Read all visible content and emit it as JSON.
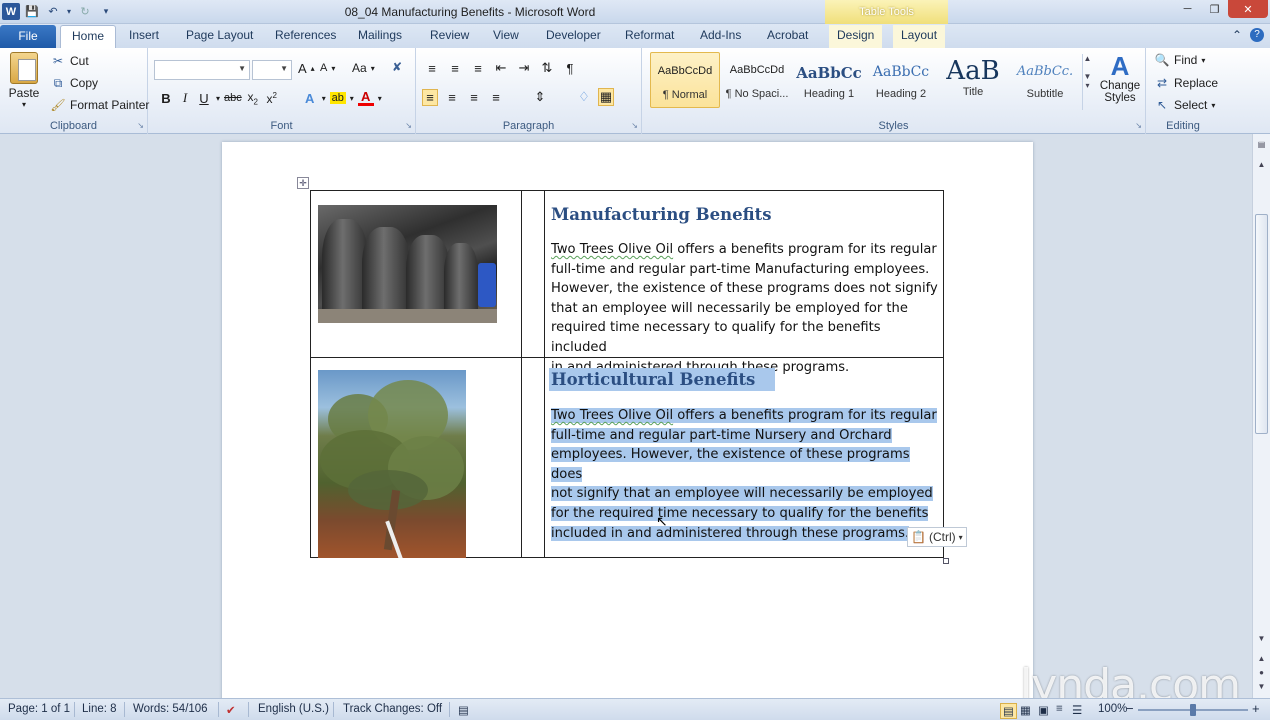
{
  "app": {
    "window_title": "08_04 Manufacturing Benefits - Microsoft Word",
    "contextual_group": "Table Tools"
  },
  "tabs": {
    "file": "File",
    "items": [
      "Home",
      "Insert",
      "Page Layout",
      "References",
      "Mailings",
      "Review",
      "View",
      "Developer",
      "Reformat",
      "Add-Ins",
      "Acrobat",
      "Design",
      "Layout"
    ],
    "active": "Home"
  },
  "ribbon": {
    "clipboard": {
      "label": "Clipboard",
      "paste": "Paste",
      "cut": "Cut",
      "copy": "Copy",
      "format_painter": "Format Painter"
    },
    "font": {
      "label": "Font",
      "font_name": "",
      "font_size": ""
    },
    "paragraph": {
      "label": "Paragraph"
    },
    "styles": {
      "label": "Styles",
      "items": [
        {
          "sample": "AaBbCcDd",
          "name": "¶ Normal"
        },
        {
          "sample": "AaBbCcDd",
          "name": "¶ No Spaci..."
        },
        {
          "sample": "AaBbCc",
          "name": "Heading 1"
        },
        {
          "sample": "AaBbCc",
          "name": "Heading 2"
        },
        {
          "sample": "AaB",
          "name": "Title"
        },
        {
          "sample": "AaBbCc.",
          "name": "Subtitle"
        }
      ],
      "change_styles": "Change Styles"
    },
    "editing": {
      "label": "Editing",
      "find": "Find",
      "replace": "Replace",
      "select": "Select"
    }
  },
  "document": {
    "section1": {
      "heading": "Manufacturing Benefits",
      "company": "Two Trees Olive Oil",
      "lines": [
        " offers a benefits program for its regular",
        "full-time and regular part-time Manufacturing employees.",
        "However, the existence of these programs does not signify",
        "that an employee will necessarily be employed for the",
        "required time necessary to qualify for the benefits included",
        "in and administered through these programs."
      ]
    },
    "section2": {
      "heading": "Horticultural Benefits",
      "company": "Two Trees Olive Oil",
      "lines": [
        " offers a benefits program for its regular",
        "full-time and regular part-time Nursery and Orchard",
        "employees. However, the existence of these programs does",
        "not signify that an employee will necessarily be employed",
        "for the required time necessary to qualify for the benefits",
        "included in and administered through these programs."
      ]
    },
    "paste_options": "(Ctrl)"
  },
  "status": {
    "page": "Page: 1 of 1",
    "line": "Line: 8",
    "words": "Words: 54/106",
    "language": "English (U.S.)",
    "track_changes": "Track Changes: Off",
    "zoom": "100%"
  },
  "watermark": "lynda.com",
  "colors": {
    "heading": "#2b4e82",
    "selection": "#a9c8ec",
    "file_tab": "#1f5aa8"
  }
}
